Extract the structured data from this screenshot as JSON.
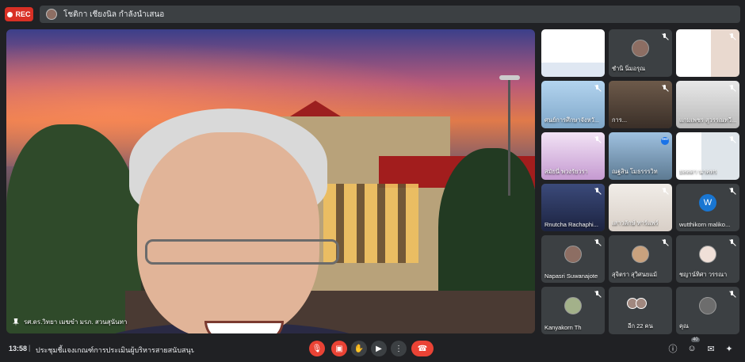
{
  "topbar": {
    "rec_label": "REC",
    "presenter_text": "โชติกา เชียงนิล กำลังนำเสนอ"
  },
  "main_tile": {
    "name": "รศ.ดร.วิทยา เมฆขำ มรภ. สวนสุนันทา"
  },
  "tiles": [
    {
      "name": "",
      "mic_muted": true
    },
    {
      "name": "ชำนิ นิ่มอรุณ",
      "mic_muted": true
    },
    {
      "name": "",
      "mic_muted": true
    },
    {
      "name": "ศนย์การศึกษาจังหวั...",
      "mic_muted": true
    },
    {
      "name": "การ...",
      "mic_muted": true
    },
    {
      "name": "แกมเพชร สุวรรณทวี...",
      "mic_muted": true
    },
    {
      "name": "สมัยนี่ พวงรัยวรา",
      "mic_muted": true
    },
    {
      "name": "ณฐสิน โมธรรรวิท",
      "mic_muted": false
    },
    {
      "name": "ยลลดา นาคทร",
      "mic_muted": true
    },
    {
      "name": "Rnutcha Rachaphi...",
      "mic_muted": true
    },
    {
      "name": "เสาวลักษ์ ทาร์แพร์",
      "mic_muted": true
    },
    {
      "name": "wutthikorn maliko...",
      "mic_muted": true,
      "initial": "W"
    },
    {
      "name": "Napasri Suwanajote",
      "mic_muted": true
    },
    {
      "name": "สุจิตรา สุวิศนยแม้",
      "mic_muted": true
    },
    {
      "name": "ชญาน์ทิศา วรรณา",
      "mic_muted": true
    },
    {
      "name": "Kanyakorn Th",
      "mic_muted": true
    },
    {
      "name": "อีก 22 คน",
      "mic_muted": false
    },
    {
      "name": "คุณ",
      "mic_muted": true
    }
  ],
  "bottombar": {
    "time": "13:58",
    "separator": "|",
    "meeting_title": "ประชุมชี้แจงเกณฑ์การประเมินผู้บริหารสายสนับสนุน ปีงบประ...",
    "participants_count": "40"
  },
  "colors": {
    "background": "#202124",
    "tile": "#3c4043",
    "danger": "#ea4335",
    "accent": "#1a73e8"
  }
}
